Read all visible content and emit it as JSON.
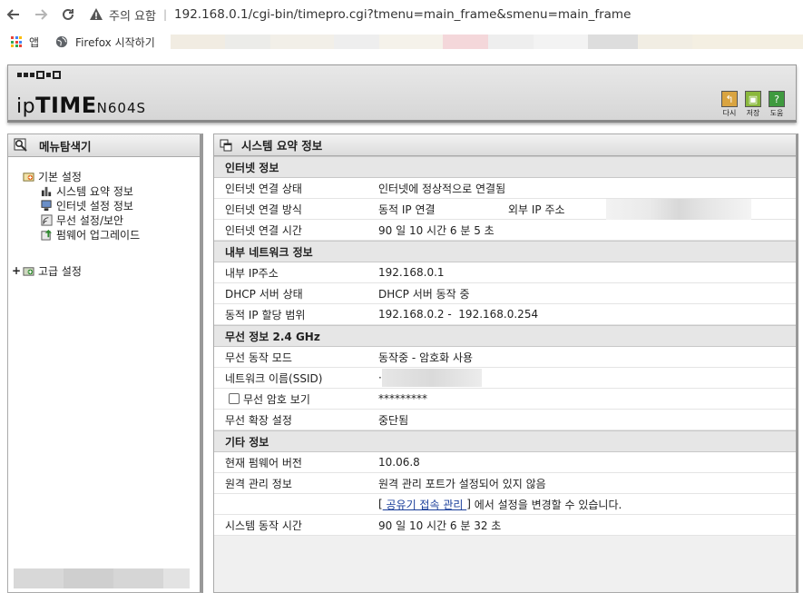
{
  "browser": {
    "security_label": "주의 요함",
    "url": "192.168.0.1/cgi-bin/timepro.cgi?tmenu=main_frame&smenu=main_frame",
    "bookmarks": [
      {
        "label": "앱",
        "icon": "apps-grid-icon"
      },
      {
        "label": "Firefox 시작하기",
        "icon": "globe-icon"
      }
    ]
  },
  "header": {
    "logo_ip": "ip",
    "logo_time": "TIME",
    "logo_model": "N604S",
    "tools": [
      {
        "label": "다시",
        "icon": "refresh-icon",
        "color": "#d9a441"
      },
      {
        "label": "저장",
        "icon": "save-icon",
        "color": "#8ab83c"
      },
      {
        "label": "도움",
        "icon": "help-icon",
        "color": "#3f9a3f"
      }
    ]
  },
  "menu": {
    "title": "메뉴탐색기",
    "groups": [
      {
        "label": "기본 설정",
        "expanded": true,
        "items": [
          {
            "label": "시스템 요약 정보",
            "icon": "bar-chart-icon"
          },
          {
            "label": "인터넷 설정 정보",
            "icon": "computer-icon"
          },
          {
            "label": "무선 설정/보안",
            "icon": "wireless-icon"
          },
          {
            "label": "펌웨어 업그레이드",
            "icon": "upgrade-icon"
          }
        ]
      },
      {
        "label": "고급 설정",
        "expanded": false,
        "toggle": "+"
      }
    ]
  },
  "main": {
    "title": "시스템 요약 정보",
    "sections": {
      "internet": {
        "title": "인터넷 정보",
        "conn_status_label": "인터넷 연결 상태",
        "conn_status_value": "인터넷에 정상적으로 연결됨",
        "conn_method_label": "인터넷 연결 방식",
        "conn_method_value": "동적 IP 연결",
        "external_ip_label": "외부 IP 주소",
        "conn_time_label": "인터넷 연결 시간",
        "conn_time_value": "90 일 10 시간 6 분 5 초"
      },
      "lan": {
        "title": "내부 네트워크 정보",
        "ip_label": "내부 IP주소",
        "ip_value": "192.168.0.1",
        "dhcp_label": "DHCP 서버 상태",
        "dhcp_value": "DHCP 서버 동작 중",
        "range_label": "동적 IP 할당 범위",
        "range_value": "192.168.0.2 -  192.168.0.254"
      },
      "wireless": {
        "title": "무선 정보 2.4 GHz",
        "mode_label": "무선 동작 모드",
        "mode_value": "동작중 - 암호화 사용",
        "ssid_label": "네트워크 이름(SSID)",
        "ssid_prefix": "·",
        "show_pw_label": "무선 암호 보기",
        "pw_value": "*********",
        "ext_label": "무선 확장 설정",
        "ext_value": "중단됨"
      },
      "other": {
        "title": "기타 정보",
        "fw_label": "현재 펌웨어 버전",
        "fw_value": "10.06.8",
        "remote_label": "원격 관리 정보",
        "remote_value": "원격 관리 포트가 설정되어 있지 않음",
        "remote_link_open": "[",
        "remote_link": " 공유기 접속 관리 ",
        "remote_link_close": "]",
        "remote_hint": " 에서 설정을 변경할 수 있습니다.",
        "uptime_label": "시스템 동작 시간",
        "uptime_value": "90 일 10 시간 6 분 32 초"
      }
    }
  },
  "colors": {
    "panel_bg": "#f0f0f0",
    "section_bg": "#e6e6e6",
    "link": "#1a3e9a"
  }
}
